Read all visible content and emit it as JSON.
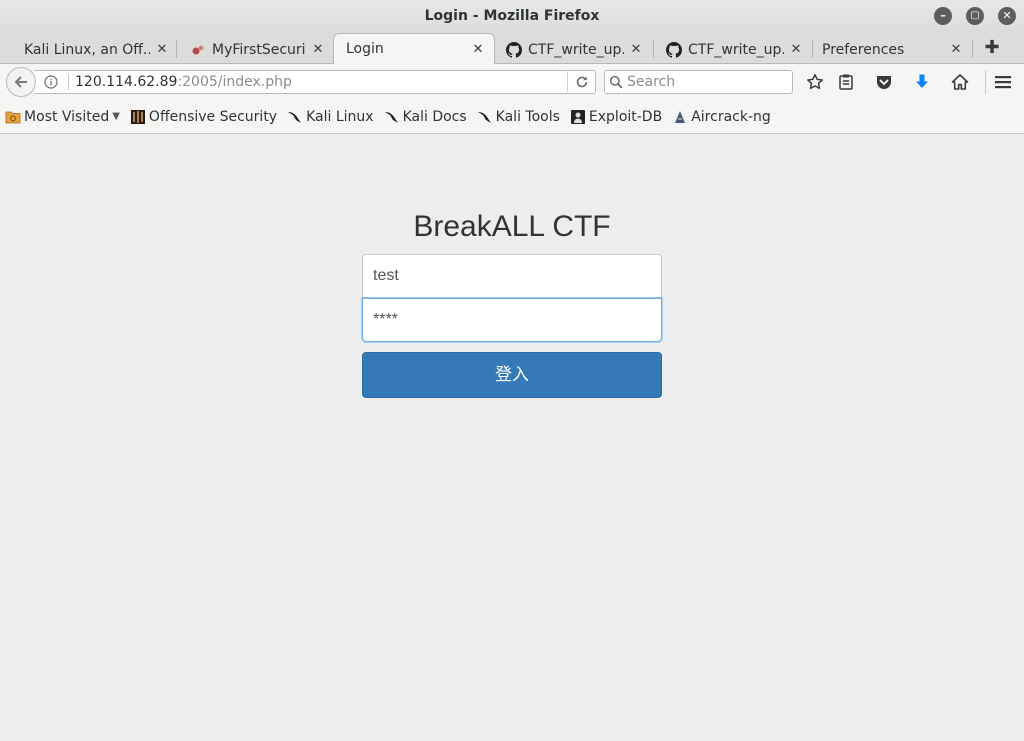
{
  "window": {
    "title": "Login - Mozilla Firefox",
    "controls": [
      "minimize",
      "maximize",
      "close"
    ]
  },
  "tabs": [
    {
      "label": "Kali Linux, an Off...",
      "icon": "none",
      "active": false
    },
    {
      "label": "MyFirstSecurity",
      "icon": "blog-icon",
      "active": false
    },
    {
      "label": "Login",
      "icon": "none",
      "active": true
    },
    {
      "label": "CTF_write_up...",
      "icon": "github-icon",
      "active": false
    },
    {
      "label": "CTF_write_up...",
      "icon": "github-icon",
      "active": false
    },
    {
      "label": "Preferences",
      "icon": "none",
      "active": false
    }
  ],
  "navbar": {
    "url_host": "120.114.62.89",
    "url_path": ":2005/index.php",
    "search_placeholder": "Search"
  },
  "bookmarks": [
    {
      "label": "Most Visited",
      "icon": "folder-icon",
      "dropdown": true
    },
    {
      "label": "Offensive Security",
      "icon": "offsec-icon"
    },
    {
      "label": "Kali Linux",
      "icon": "kali-dragon-icon"
    },
    {
      "label": "Kali Docs",
      "icon": "kali-dragon-icon"
    },
    {
      "label": "Kali Tools",
      "icon": "kali-dragon-icon"
    },
    {
      "label": "Exploit-DB",
      "icon": "exploitdb-icon"
    },
    {
      "label": "Aircrack-ng",
      "icon": "aircrack-icon"
    }
  ],
  "login": {
    "title": "BreakALL CTF",
    "username_value": "test",
    "password_value": "****",
    "submit_label": "登入"
  },
  "colors": {
    "button": "#337ab7",
    "focus_border": "#66afe9",
    "download_arrow": "#0a84ff"
  }
}
